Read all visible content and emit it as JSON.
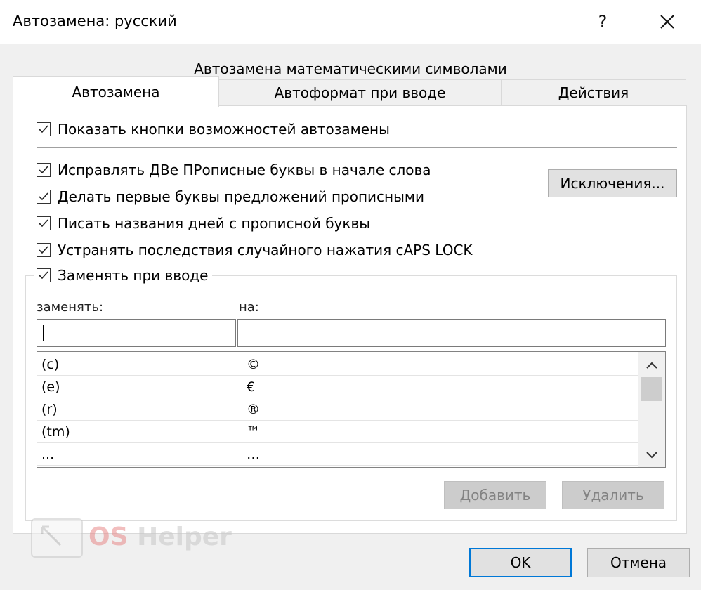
{
  "window": {
    "title": "Автозамена: русский",
    "help_label": "?",
    "close_label": "✕"
  },
  "tabs": {
    "top_row": [
      "Автозамена математическими символами"
    ],
    "bottom_row": [
      "Автозамена",
      "Автоформат при вводе",
      "Действия"
    ],
    "active": "Автозамена"
  },
  "options": {
    "show_buttons": {
      "label": "Показать кнопки возможностей автозамены",
      "checked": true
    },
    "correct_two_caps": {
      "label": "Исправлять ДВе ПРописные буквы в начале слова",
      "checked": true
    },
    "capitalize_sentences": {
      "label": "Делать первые буквы предложений прописными",
      "checked": true
    },
    "capitalize_days": {
      "label": "Писать названия дней с прописной буквы",
      "checked": true
    },
    "caps_lock": {
      "label": "Устранять последствия случайного нажатия cAPS LOCK",
      "checked": true
    },
    "replace_as_type": {
      "label": "Заменять при вводе",
      "checked": true
    }
  },
  "exceptions_button": "Исключения...",
  "replace": {
    "replace_label": "заменять:",
    "with_label": "на:",
    "replace_value": "",
    "with_value": ""
  },
  "table": {
    "rows": [
      {
        "replace": "(c)",
        "with": "©"
      },
      {
        "replace": "(e)",
        "with": "€"
      },
      {
        "replace": "(r)",
        "with": "®"
      },
      {
        "replace": "(tm)",
        "with": "™"
      },
      {
        "replace": "...",
        "with": "…"
      }
    ]
  },
  "buttons": {
    "add": "Добавить",
    "delete": "Удалить",
    "ok": "OK",
    "cancel": "Отмена"
  },
  "watermark": {
    "brand_os": "OS",
    "brand_helper": " Helper"
  },
  "colors": {
    "dialog_bg": "#f0f0f0",
    "panel_bg": "#ffffff",
    "ok_border": "#0078d7",
    "disabled_text": "#838383"
  }
}
